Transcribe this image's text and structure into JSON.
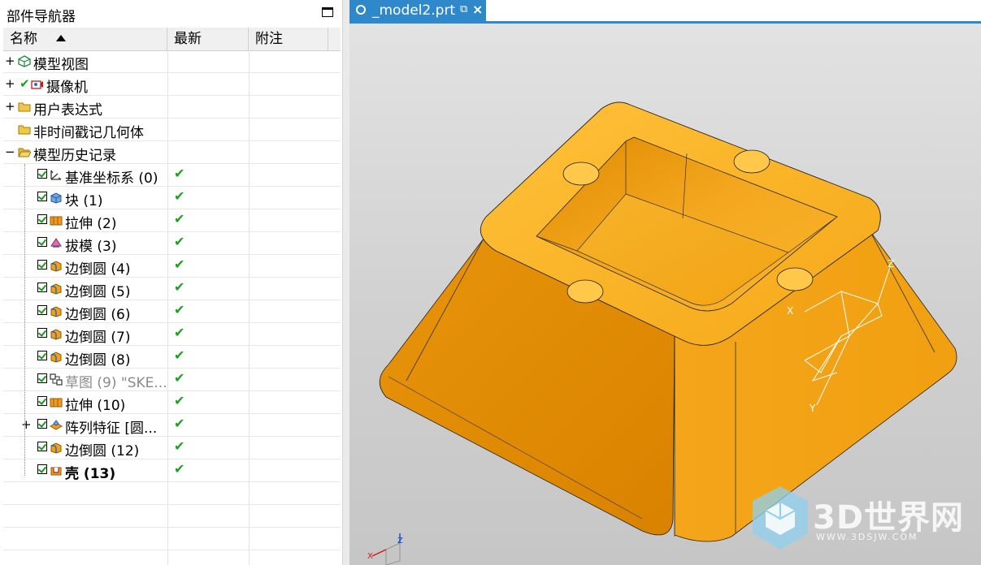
{
  "navigator": {
    "title": "部件导航器",
    "columns": {
      "name": "名称",
      "latest": "最新",
      "note": "附注"
    },
    "rows": [
      {
        "label": "模型视图",
        "expander": "+",
        "indent": 0,
        "icon": "model-view-icon",
        "latest": ""
      },
      {
        "label": "摄像机",
        "expander": "+",
        "indent": 0,
        "icon": "camera-icon",
        "visible_check": "✔",
        "latest": ""
      },
      {
        "label": "用户表达式",
        "expander": "+",
        "indent": 0,
        "icon": "folder-icon",
        "latest": ""
      },
      {
        "label": "非时间戳记几何体",
        "expander": "",
        "indent": 0,
        "icon": "folder-icon",
        "latest": ""
      },
      {
        "label": "模型历史记录",
        "expander": "−",
        "indent": 0,
        "icon": "folder-open-icon",
        "latest": ""
      },
      {
        "label": "基准坐标系 (0)",
        "indent": 1,
        "icon": "datum-csys-icon",
        "checkbox": true,
        "latest": "✔"
      },
      {
        "label": "块 (1)",
        "indent": 1,
        "icon": "block-icon",
        "checkbox": true,
        "latest": "✔"
      },
      {
        "label": "拉伸 (2)",
        "indent": 1,
        "icon": "extrude-icon",
        "checkbox": true,
        "latest": "✔"
      },
      {
        "label": "拔模 (3)",
        "indent": 1,
        "icon": "draft-icon",
        "checkbox": true,
        "latest": "✔"
      },
      {
        "label": "边倒圆 (4)",
        "indent": 1,
        "icon": "edge-blend-icon",
        "checkbox": true,
        "latest": "✔"
      },
      {
        "label": "边倒圆 (5)",
        "indent": 1,
        "icon": "edge-blend-icon",
        "checkbox": true,
        "latest": "✔"
      },
      {
        "label": "边倒圆 (6)",
        "indent": 1,
        "icon": "edge-blend-icon",
        "checkbox": true,
        "latest": "✔"
      },
      {
        "label": "边倒圆 (7)",
        "indent": 1,
        "icon": "edge-blend-icon",
        "checkbox": true,
        "latest": "✔"
      },
      {
        "label": "边倒圆 (8)",
        "indent": 1,
        "icon": "edge-blend-icon",
        "checkbox": true,
        "latest": "✔"
      },
      {
        "label": "草图 (9) \"SKE...",
        "indent": 1,
        "icon": "sketch-icon",
        "checkbox": true,
        "latest": "✔",
        "style": "gray"
      },
      {
        "label": "拉伸 (10)",
        "indent": 1,
        "icon": "extrude-icon",
        "checkbox": true,
        "latest": "✔"
      },
      {
        "label": "阵列特征 [圆...",
        "indent": 1,
        "icon": "pattern-feature-icon",
        "checkbox": true,
        "expander": "+",
        "latest": "✔"
      },
      {
        "label": "边倒圆 (12)",
        "indent": 1,
        "icon": "edge-blend-icon",
        "checkbox": true,
        "latest": "✔"
      },
      {
        "label": "壳 (13)",
        "indent": 1,
        "icon": "shell-icon",
        "checkbox": true,
        "latest": "✔",
        "style": "bold"
      }
    ]
  },
  "tab": {
    "label": "_model2.prt",
    "close": "×",
    "pin": "⧉"
  },
  "triad": {
    "x": "X",
    "y": "Y",
    "z": "Z"
  },
  "watermark": {
    "brand": "3D世界网",
    "url": "WWW.3DSJW.COM"
  },
  "colors": {
    "model": "#F0A010",
    "model_dark": "#D98400",
    "tab": "#2E88C9",
    "check": "#1AA31A"
  }
}
